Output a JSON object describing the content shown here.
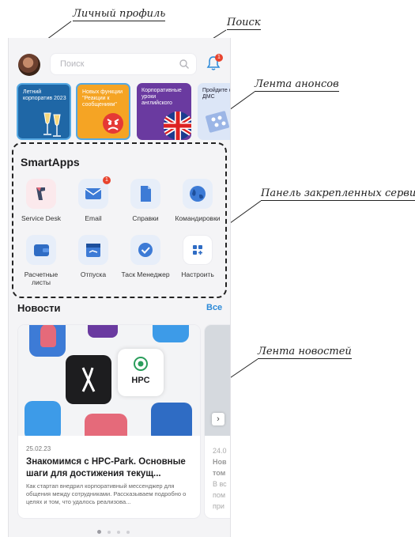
{
  "callouts": {
    "profile": "Личный профиль",
    "search": "Поиск",
    "announcements": "Лента анонсов",
    "pinned_services": "Панель закрепленных сервисов",
    "news_feed": "Лента новостей"
  },
  "topbar": {
    "search_placeholder": "Поиск",
    "notification_count": "1"
  },
  "stories": [
    {
      "text": "Летний корпоратив 2023"
    },
    {
      "text": "Новых функции \"Реакции к сообщениям\""
    },
    {
      "text": "Корпоративные уроки английского"
    },
    {
      "text": "Пройдите с по ДМС"
    }
  ],
  "apps": {
    "title": "SmartApps",
    "items": [
      {
        "label": "Service Desk",
        "icon": "service-desk-icon"
      },
      {
        "label": "Email",
        "icon": "email-icon",
        "badge": "1"
      },
      {
        "label": "Справки",
        "icon": "document-icon"
      },
      {
        "label": "Командировки",
        "icon": "globe-icon"
      },
      {
        "label": "Расчетные листы",
        "icon": "wallet-icon"
      },
      {
        "label": "Отпуска",
        "icon": "calendar-icon"
      },
      {
        "label": "Таск Менеджер",
        "icon": "task-check-icon"
      },
      {
        "label": "Настроить",
        "icon": "settings-grid-icon"
      }
    ]
  },
  "news": {
    "heading": "Новости",
    "all_link": "Все",
    "cards": [
      {
        "date": "25.02.23",
        "title": "Знакомимся с HPC-Park. Основные шаги для достижения текущ...",
        "description": "Как стартап внедрил корпоративный мессенджер для общения между сотрудниками. Рассказываем подробно о целях и том, что удалось реализова...",
        "logo_text": "HPC"
      },
      {
        "date": "24.0",
        "title": "Нов том",
        "description": "В вс пом при"
      }
    ]
  },
  "colors": {
    "accent": "#2c8ad8",
    "badge": "#e8442e",
    "app_tile": "#e7eef9"
  }
}
